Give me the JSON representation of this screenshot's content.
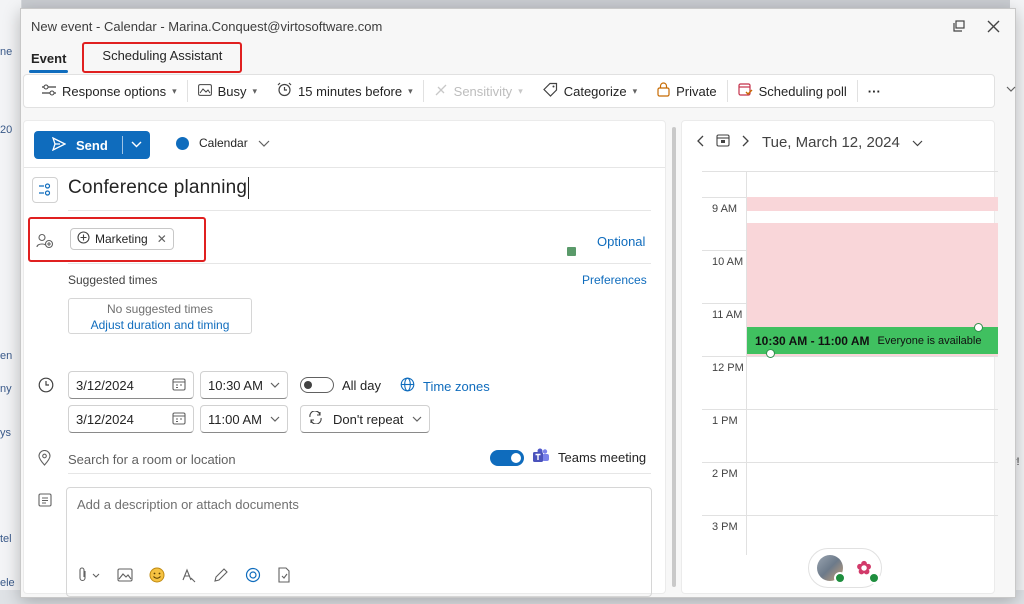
{
  "window": {
    "title": "New event - Calendar - Marina.Conquest@virtosoftware.com"
  },
  "tabs": [
    {
      "label": "Event",
      "active": true
    },
    {
      "label": "Scheduling Assistant",
      "active": false
    }
  ],
  "ribbon": {
    "response_options": "Response options",
    "busy": "Busy",
    "reminder": "15 minutes before",
    "sensitivity": "Sensitivity",
    "categorize": "Categorize",
    "private": "Private",
    "scheduling_poll": "Scheduling poll",
    "more": "···"
  },
  "compose": {
    "send_label": "Send",
    "calendar_label": "Calendar",
    "calendar_color": "#0f6cbd",
    "title": "Conference planning",
    "attendee_chip": "Marketing",
    "optional_link": "Optional",
    "suggested_label": "Suggested times",
    "preferences_link": "Preferences",
    "no_suggested": "No suggested times",
    "adjust_link": "Adjust duration and timing",
    "start_date": "3/12/2024",
    "start_time": "10:30 AM",
    "end_date": "3/12/2024",
    "end_time": "11:00 AM",
    "all_day_label": "All day",
    "all_day_on": false,
    "time_zones_link": "Time zones",
    "repeat_label": "Don't repeat",
    "location_placeholder": "Search for a room or location",
    "teams_label": "Teams meeting",
    "teams_on": true,
    "description_placeholder": "Add a description or attach documents"
  },
  "scheduler": {
    "date": "Tue, March 12, 2024",
    "hours": [
      "9 AM",
      "10 AM",
      "11 AM",
      "12 PM",
      "1 PM",
      "2 PM",
      "3 PM"
    ],
    "slot_time": "10:30 AM - 11:00 AM",
    "slot_status": "Everyone is available",
    "busy_color": "#f9d6d9",
    "slot_color": "#40c060"
  },
  "background": {
    "left_fragments": [
      "ne",
      "20",
      "en",
      "ny",
      "ys",
      "tel",
      "ele"
    ],
    "right_fragment": "y!"
  }
}
